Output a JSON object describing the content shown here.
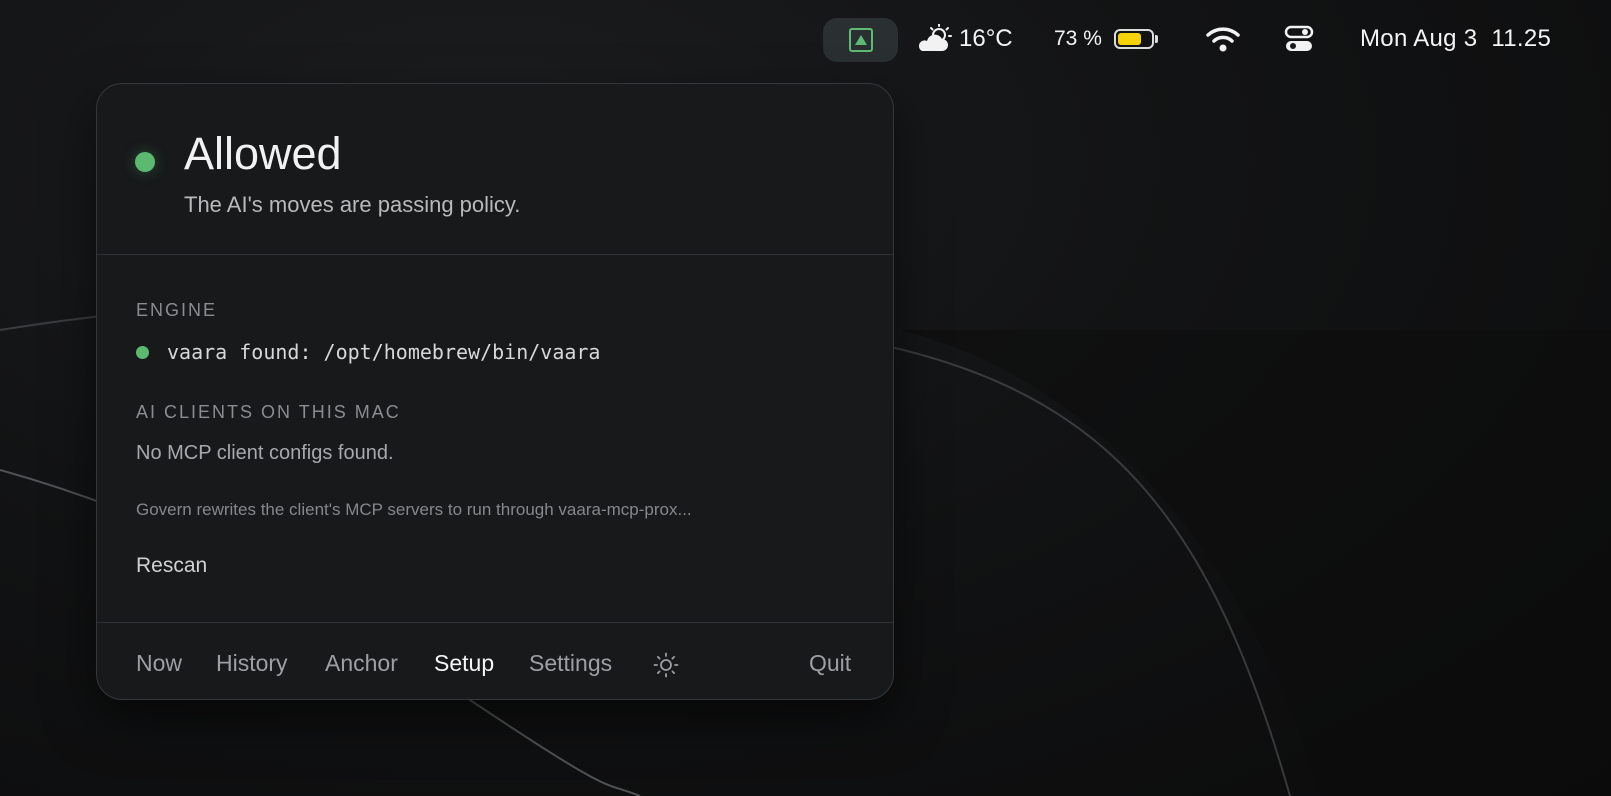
{
  "menubar": {
    "app_icon": "vaara-triangle-icon",
    "weather": {
      "icon": "partly-sunny-icon",
      "temperature": "16°C"
    },
    "battery": {
      "percent_label": "73 %",
      "level": 0.73,
      "fill_color": "#f5d20a"
    },
    "wifi_icon": "wifi-icon",
    "control_center_icon": "control-center-icon",
    "clock": "Mon Aug 3  11.25"
  },
  "popover": {
    "status": {
      "title": "Allowed",
      "subtitle": "The AI's moves are passing policy.",
      "color": "#5bba70"
    },
    "engine": {
      "label": "ENGINE",
      "status_text": "vaara found: /opt/homebrew/bin/vaara"
    },
    "clients": {
      "label": "AI CLIENTS ON THIS MAC",
      "empty_text": "No MCP client configs found.",
      "note": "Govern rewrites the client's MCP servers to run through vaara-mcp-prox..."
    },
    "rescan_label": "Rescan",
    "tabs": [
      {
        "label": "Now"
      },
      {
        "label": "History"
      },
      {
        "label": "Anchor"
      },
      {
        "label": "Setup"
      },
      {
        "label": "Settings"
      }
    ],
    "active_tab": "Setup",
    "theme_icon": "sun-icon",
    "quit_label": "Quit"
  },
  "colors": {
    "accent_green": "#5bba70",
    "panel_bg": "#17191b"
  }
}
